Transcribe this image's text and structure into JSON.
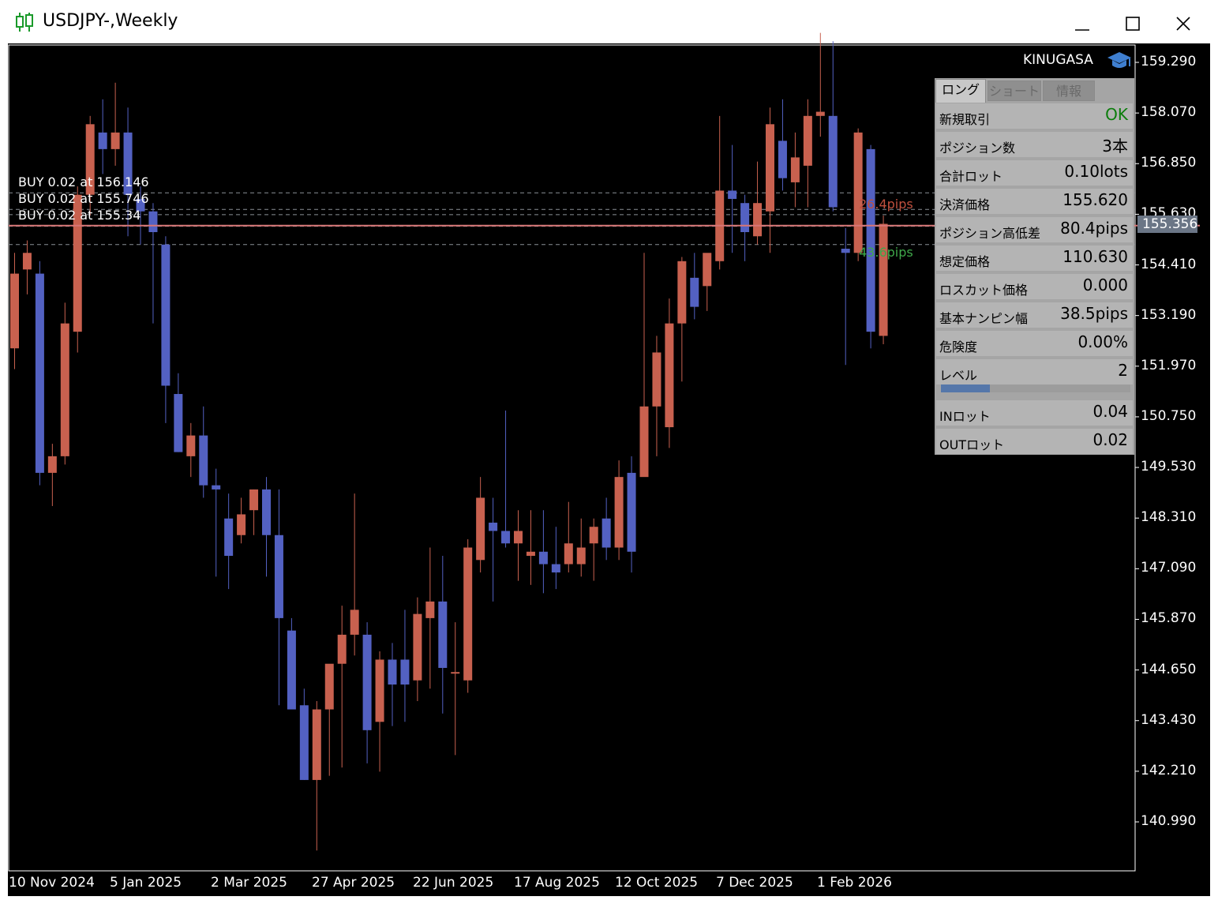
{
  "window": {
    "title": "USDJPY-,Weekly",
    "controls": {
      "minimize": "minimize-icon",
      "maximize": "maximize-icon",
      "close": "close-icon"
    }
  },
  "colors": {
    "bull": "#c8614f",
    "bear": "#5361c2",
    "chart_bg": "#000000",
    "current_price_line": "#d87676",
    "order_line": "#8a8f96",
    "pips_up": "#c0503e",
    "pips_down": "#3fa84a"
  },
  "branding": {
    "name": "KINUGASA",
    "icon": "graduation-cap-icon"
  },
  "orders": [
    {
      "text": "BUY 0.02 at 156.146"
    },
    {
      "text": "BUY 0.02 at 155.746"
    },
    {
      "text": "BUY 0.02 at 155.34"
    }
  ],
  "pips": {
    "up": "26.4pips",
    "down": "43.6pips"
  },
  "price_axis": {
    "ticks": [
      "159.290",
      "158.070",
      "156.850",
      "155.630",
      "154.410",
      "153.190",
      "151.970",
      "150.750",
      "149.530",
      "148.310",
      "147.090",
      "145.870",
      "144.650",
      "143.430",
      "142.210",
      "140.990"
    ],
    "current": "155.356"
  },
  "time_axis": {
    "labels": [
      "10 Nov 2024",
      "5 Jan 2025",
      "2 Mar 2025",
      "27 Apr 2025",
      "22 Jun 2025",
      "17 Aug 2025",
      "12 Oct 2025",
      "7 Dec 2025",
      "1 Feb 2026"
    ]
  },
  "panel": {
    "tabs": [
      {
        "label": "ロング",
        "active": true
      },
      {
        "label": "ショート",
        "active": false
      },
      {
        "label": "情報",
        "active": false
      }
    ],
    "rows": [
      {
        "label": "新規取引",
        "value": "OK"
      },
      {
        "label": "ポジション数",
        "value": "3本"
      },
      {
        "label": "合計ロット",
        "value": "0.10lots"
      },
      {
        "label": "決済価格",
        "value": "155.620"
      },
      {
        "label": "ポジション高低差",
        "value": "80.4pips"
      },
      {
        "label": "想定価格",
        "value": "110.630"
      },
      {
        "label": "ロスカット価格",
        "value": "0.000"
      },
      {
        "label": "基本ナンピン幅",
        "value": "38.5pips"
      },
      {
        "label": "危険度",
        "value": "0.00%"
      },
      {
        "label": "レベル",
        "value": "2"
      },
      {
        "label": "INロット",
        "value": "0.04"
      },
      {
        "label": "OUTロット",
        "value": "0.02"
      }
    ],
    "level_progress": 0.26
  },
  "chart_data": {
    "type": "candlestick",
    "symbol": "USDJPY-",
    "timeframe": "Weekly",
    "y_ticks": [
      159.29,
      158.07,
      156.85,
      155.63,
      154.41,
      153.19,
      151.97,
      150.75,
      149.53,
      148.31,
      147.09,
      145.87,
      144.65,
      143.43,
      142.21,
      140.99
    ],
    "current_price": 155.356,
    "order_prices": [
      156.146,
      155.746,
      155.34
    ],
    "series": [
      {
        "o": 152.4,
        "h": 154.7,
        "l": 151.9,
        "c": 154.2
      },
      {
        "o": 154.3,
        "h": 155.0,
        "l": 153.7,
        "c": 154.7
      },
      {
        "o": 154.2,
        "h": 154.5,
        "l": 149.1,
        "c": 149.4
      },
      {
        "o": 149.4,
        "h": 150.1,
        "l": 148.6,
        "c": 149.8
      },
      {
        "o": 149.8,
        "h": 153.5,
        "l": 149.6,
        "c": 153.0
      },
      {
        "o": 152.8,
        "h": 156.3,
        "l": 152.3,
        "c": 156.1
      },
      {
        "o": 156.1,
        "h": 158.0,
        "l": 155.6,
        "c": 157.8
      },
      {
        "o": 157.6,
        "h": 158.4,
        "l": 156.6,
        "c": 157.2
      },
      {
        "o": 157.2,
        "h": 158.8,
        "l": 156.8,
        "c": 157.6
      },
      {
        "o": 157.6,
        "h": 158.2,
        "l": 155.1,
        "c": 156.1
      },
      {
        "o": 156.0,
        "h": 156.3,
        "l": 154.9,
        "c": 155.7
      },
      {
        "o": 155.7,
        "h": 155.9,
        "l": 153.0,
        "c": 155.2
      },
      {
        "o": 154.9,
        "h": 155.1,
        "l": 150.6,
        "c": 151.5
      },
      {
        "o": 151.3,
        "h": 151.8,
        "l": 149.9,
        "c": 149.9
      },
      {
        "o": 149.8,
        "h": 150.6,
        "l": 149.3,
        "c": 150.3
      },
      {
        "o": 150.3,
        "h": 151.0,
        "l": 148.8,
        "c": 149.1
      },
      {
        "o": 149.1,
        "h": 149.5,
        "l": 146.9,
        "c": 149.0
      },
      {
        "o": 148.3,
        "h": 148.9,
        "l": 146.6,
        "c": 147.4
      },
      {
        "o": 147.9,
        "h": 148.8,
        "l": 147.7,
        "c": 148.4
      },
      {
        "o": 148.5,
        "h": 149.0,
        "l": 147.9,
        "c": 149.0
      },
      {
        "o": 149.0,
        "h": 149.3,
        "l": 146.9,
        "c": 147.9
      },
      {
        "o": 147.9,
        "h": 149.0,
        "l": 143.8,
        "c": 145.9
      },
      {
        "o": 145.6,
        "h": 145.9,
        "l": 143.9,
        "c": 143.7
      },
      {
        "o": 143.8,
        "h": 144.2,
        "l": 142.0,
        "c": 142.0
      },
      {
        "o": 142.0,
        "h": 143.9,
        "l": 140.3,
        "c": 143.7
      },
      {
        "o": 143.7,
        "h": 144.6,
        "l": 142.1,
        "c": 144.8
      },
      {
        "o": 144.8,
        "h": 146.2,
        "l": 142.3,
        "c": 145.5
      },
      {
        "o": 145.5,
        "h": 148.9,
        "l": 145.0,
        "c": 146.1
      },
      {
        "o": 145.5,
        "h": 145.8,
        "l": 142.4,
        "c": 143.2
      },
      {
        "o": 143.4,
        "h": 145.1,
        "l": 142.2,
        "c": 144.9
      },
      {
        "o": 144.9,
        "h": 145.3,
        "l": 143.3,
        "c": 144.3
      },
      {
        "o": 144.9,
        "h": 146.1,
        "l": 143.4,
        "c": 144.3
      },
      {
        "o": 144.4,
        "h": 146.4,
        "l": 143.9,
        "c": 146.0
      },
      {
        "o": 145.9,
        "h": 147.6,
        "l": 144.2,
        "c": 146.3
      },
      {
        "o": 146.3,
        "h": 147.4,
        "l": 143.6,
        "c": 144.7
      },
      {
        "o": 144.6,
        "h": 145.8,
        "l": 142.6,
        "c": 144.6
      },
      {
        "o": 144.4,
        "h": 147.8,
        "l": 144.1,
        "c": 147.6
      },
      {
        "o": 147.3,
        "h": 149.3,
        "l": 147.0,
        "c": 148.8
      },
      {
        "o": 148.2,
        "h": 148.8,
        "l": 146.3,
        "c": 148.0
      },
      {
        "o": 148.0,
        "h": 150.9,
        "l": 147.6,
        "c": 147.7
      },
      {
        "o": 147.7,
        "h": 148.5,
        "l": 146.8,
        "c": 148.0
      },
      {
        "o": 147.4,
        "h": 148.5,
        "l": 146.7,
        "c": 147.5
      },
      {
        "o": 147.5,
        "h": 148.5,
        "l": 146.5,
        "c": 147.2
      },
      {
        "o": 147.2,
        "h": 148.1,
        "l": 146.6,
        "c": 147.0
      },
      {
        "o": 147.2,
        "h": 148.7,
        "l": 147.0,
        "c": 147.7
      },
      {
        "o": 147.2,
        "h": 148.3,
        "l": 146.9,
        "c": 147.6
      },
      {
        "o": 147.7,
        "h": 148.3,
        "l": 146.8,
        "c": 148.1
      },
      {
        "o": 148.3,
        "h": 148.8,
        "l": 147.3,
        "c": 147.6
      },
      {
        "o": 147.6,
        "h": 149.7,
        "l": 147.3,
        "c": 149.3
      },
      {
        "o": 149.4,
        "h": 149.8,
        "l": 147.0,
        "c": 147.5
      },
      {
        "o": 149.3,
        "h": 154.7,
        "l": 149.6,
        "c": 151.0
      },
      {
        "o": 151.0,
        "h": 152.7,
        "l": 149.8,
        "c": 152.3
      },
      {
        "o": 150.5,
        "h": 153.6,
        "l": 150.0,
        "c": 153.0
      },
      {
        "o": 153.0,
        "h": 154.6,
        "l": 151.6,
        "c": 154.5
      },
      {
        "o": 154.1,
        "h": 154.7,
        "l": 153.1,
        "c": 153.4
      },
      {
        "o": 153.9,
        "h": 154.5,
        "l": 153.3,
        "c": 154.7
      },
      {
        "o": 154.5,
        "h": 158.0,
        "l": 154.3,
        "c": 156.2
      },
      {
        "o": 156.2,
        "h": 157.3,
        "l": 154.7,
        "c": 156.0
      },
      {
        "o": 155.9,
        "h": 156.1,
        "l": 154.5,
        "c": 155.2
      },
      {
        "o": 155.1,
        "h": 156.9,
        "l": 154.9,
        "c": 155.9
      },
      {
        "o": 155.7,
        "h": 158.2,
        "l": 154.7,
        "c": 157.8
      },
      {
        "o": 157.4,
        "h": 158.4,
        "l": 156.2,
        "c": 156.5
      },
      {
        "o": 156.4,
        "h": 157.6,
        "l": 155.8,
        "c": 157.0
      },
      {
        "o": 156.8,
        "h": 158.4,
        "l": 155.8,
        "c": 158.0
      },
      {
        "o": 158.0,
        "h": 160.0,
        "l": 157.5,
        "c": 158.1
      },
      {
        "o": 158.0,
        "h": 159.8,
        "l": 155.7,
        "c": 155.8
      },
      {
        "o": 154.8,
        "h": 155.3,
        "l": 152.0,
        "c": 154.7
      },
      {
        "o": 154.7,
        "h": 157.7,
        "l": 154.5,
        "c": 157.6
      },
      {
        "o": 157.2,
        "h": 157.3,
        "l": 152.4,
        "c": 152.8
      },
      {
        "o": 152.7,
        "h": 155.6,
        "l": 152.5,
        "c": 155.4
      }
    ]
  }
}
